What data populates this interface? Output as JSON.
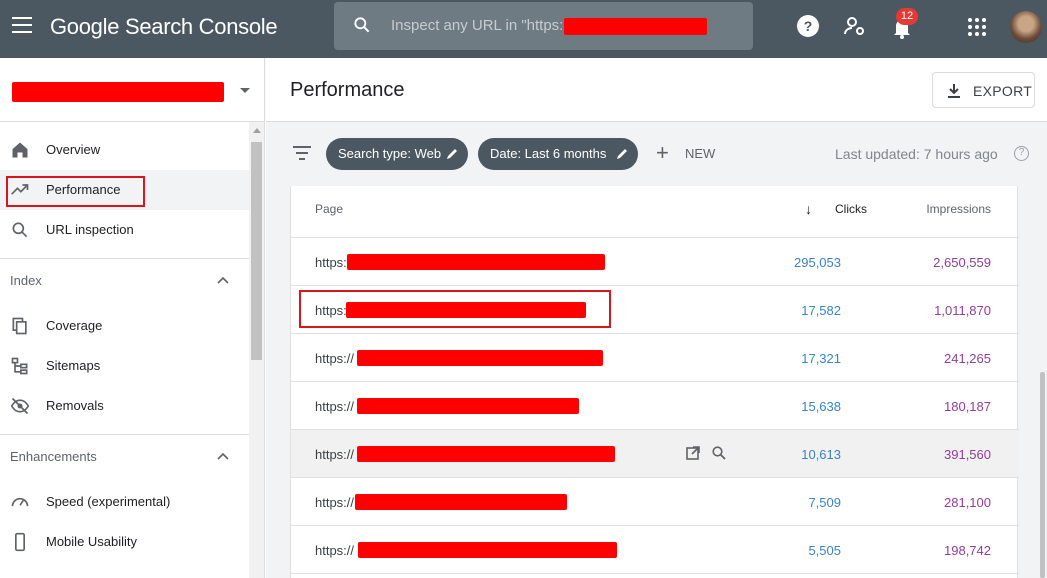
{
  "app": {
    "logo_text": "Google Search Console",
    "search_placeholder": "Inspect any URL in \"https:",
    "notification_count": "12"
  },
  "sidebar": {
    "items_top": [
      {
        "label": "Overview",
        "icon": "home-icon"
      },
      {
        "label": "Performance",
        "icon": "trending-up-icon",
        "active": true
      },
      {
        "label": "URL inspection",
        "icon": "search-icon"
      }
    ],
    "sections": [
      {
        "label": "Index",
        "items": [
          {
            "label": "Coverage",
            "icon": "coverage-icon"
          },
          {
            "label": "Sitemaps",
            "icon": "sitemap-icon"
          },
          {
            "label": "Removals",
            "icon": "eye-off-icon"
          }
        ]
      },
      {
        "label": "Enhancements",
        "items": [
          {
            "label": "Speed (experimental)",
            "icon": "speedometer-icon"
          },
          {
            "label": "Mobile Usability",
            "icon": "phone-icon"
          }
        ]
      }
    ]
  },
  "header": {
    "title": "Performance",
    "export_label": "EXPORT"
  },
  "filters": {
    "chips": [
      "Search type: Web",
      "Date: Last 6 months"
    ],
    "new_label": "NEW",
    "last_updated": "Last updated: 7 hours ago",
    "help_glyph": "?"
  },
  "table": {
    "columns": {
      "page": "Page",
      "clicks": "Clicks",
      "impressions": "Impressions"
    },
    "sort_glyph": "↓",
    "rows": [
      {
        "url": "https:",
        "clicks": "295,053",
        "impressions": "2,650,559"
      },
      {
        "url": "https:",
        "clicks": "17,582",
        "impressions": "1,011,870"
      },
      {
        "url": "https://",
        "clicks": "17,321",
        "impressions": "241,265"
      },
      {
        "url": "https://",
        "clicks": "15,638",
        "impressions": "180,187"
      },
      {
        "url": "https://",
        "clicks": "10,613",
        "impressions": "391,560"
      },
      {
        "url": "https://",
        "clicks": "7,509",
        "impressions": "281,100"
      },
      {
        "url": "https://",
        "clicks": "5,505",
        "impressions": "198,742"
      }
    ]
  },
  "colors": {
    "topbar": "#4b5861",
    "clicks": "#3a83c4",
    "impressions": "#8e3f97",
    "annotation_red": "#d9161b"
  }
}
